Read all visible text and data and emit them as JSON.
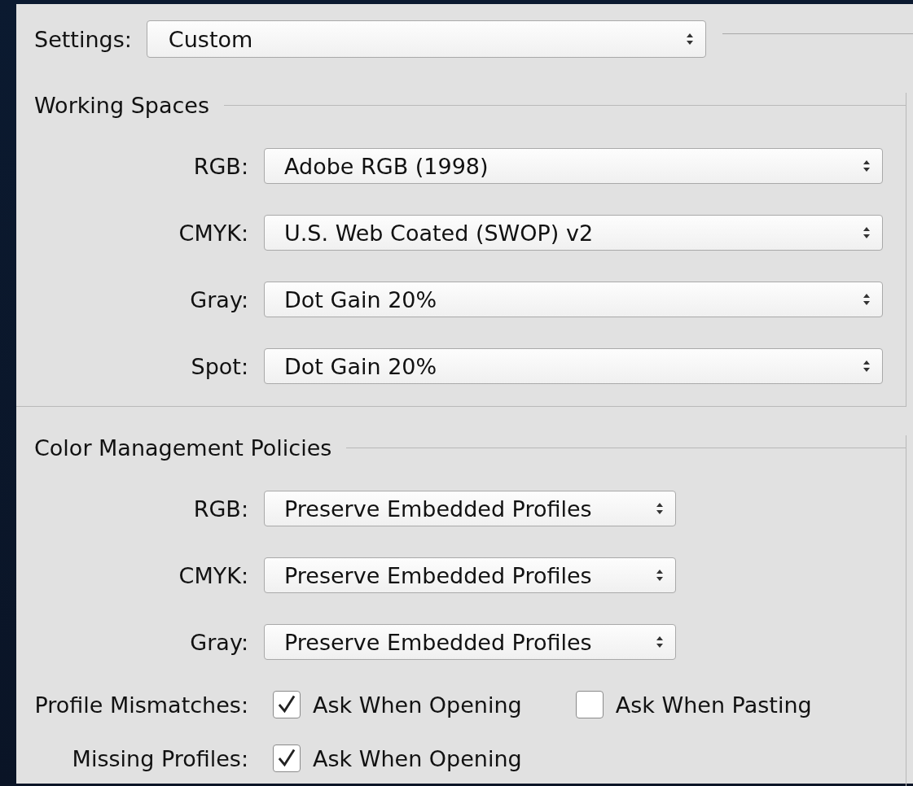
{
  "settings": {
    "label": "Settings:",
    "value": "Custom"
  },
  "working_spaces": {
    "title": "Working Spaces",
    "rows": [
      {
        "label": "RGB:",
        "value": "Adobe RGB (1998)"
      },
      {
        "label": "CMYK:",
        "value": "U.S. Web Coated (SWOP) v2"
      },
      {
        "label": "Gray:",
        "value": "Dot Gain 20%"
      },
      {
        "label": "Spot:",
        "value": "Dot Gain 20%"
      }
    ]
  },
  "policies": {
    "title": "Color Management Policies",
    "rows": [
      {
        "label": "RGB:",
        "value": "Preserve Embedded Profiles"
      },
      {
        "label": "CMYK:",
        "value": "Preserve Embedded Profiles"
      },
      {
        "label": "Gray:",
        "value": "Preserve Embedded Profiles"
      }
    ],
    "checks": [
      {
        "label": "Profile Mismatches:",
        "options": [
          {
            "label": "Ask When Opening",
            "checked": true
          },
          {
            "label": "Ask When Pasting",
            "checked": false
          }
        ]
      },
      {
        "label": "Missing Profiles:",
        "options": [
          {
            "label": "Ask When Opening",
            "checked": true
          }
        ]
      }
    ]
  }
}
